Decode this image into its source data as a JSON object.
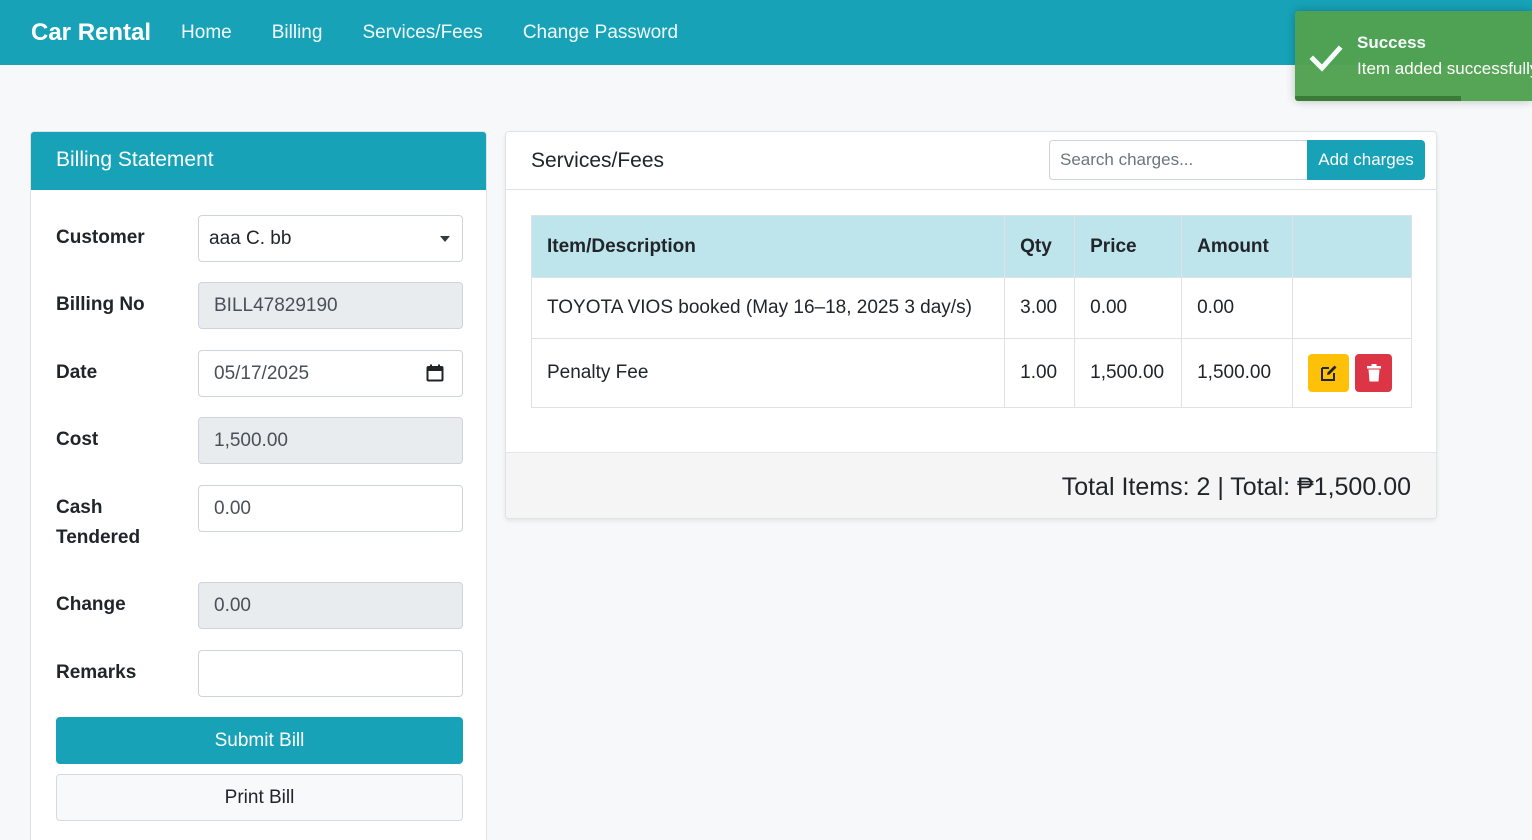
{
  "navbar": {
    "brand": "Car Rental",
    "links": [
      "Home",
      "Billing",
      "Services/Fees",
      "Change Password"
    ]
  },
  "toast": {
    "title": "Success",
    "message": "Item added successfully",
    "icon": "check-icon",
    "progress_fraction": 0.7,
    "color": "#51a351"
  },
  "billing": {
    "title": "Billing Statement",
    "fields": {
      "customer": {
        "label": "Customer",
        "value": "aaa C. bb"
      },
      "billing_no": {
        "label": "Billing No",
        "value": "BILL47829190"
      },
      "date": {
        "label": "Date",
        "value": "05/17/2025"
      },
      "cost": {
        "label": "Cost",
        "value": "1,500.00"
      },
      "cash_tendered": {
        "label_line1": "Cash",
        "label_line2": "Tendered",
        "value": "0.00"
      },
      "change": {
        "label": "Change",
        "value": "0.00"
      },
      "remarks": {
        "label": "Remarks",
        "value": ""
      }
    },
    "submit_label": "Submit Bill",
    "print_label": "Print Bill"
  },
  "services": {
    "title": "Services/Fees",
    "search_placeholder": "Search charges...",
    "add_label": "Add charges",
    "columns": [
      "Item/Description",
      "Qty",
      "Price",
      "Amount",
      ""
    ],
    "rows": [
      {
        "desc": "TOYOTA VIOS booked (May 16–18, 2025 3 day/s)",
        "qty": "3.00",
        "price": "0.00",
        "amount": "0.00",
        "actions": false
      },
      {
        "desc": "Penalty Fee",
        "qty": "1.00",
        "price": "1,500.00",
        "amount": "1,500.00",
        "actions": true
      }
    ],
    "total_text": "Total Items: 2 | Total: ₱1,500.00"
  },
  "colors": {
    "primary": "#17a2b8",
    "success": "#51a351",
    "warning": "#ffc107",
    "danger": "#dc3545",
    "table_header": "#bee5eb"
  }
}
